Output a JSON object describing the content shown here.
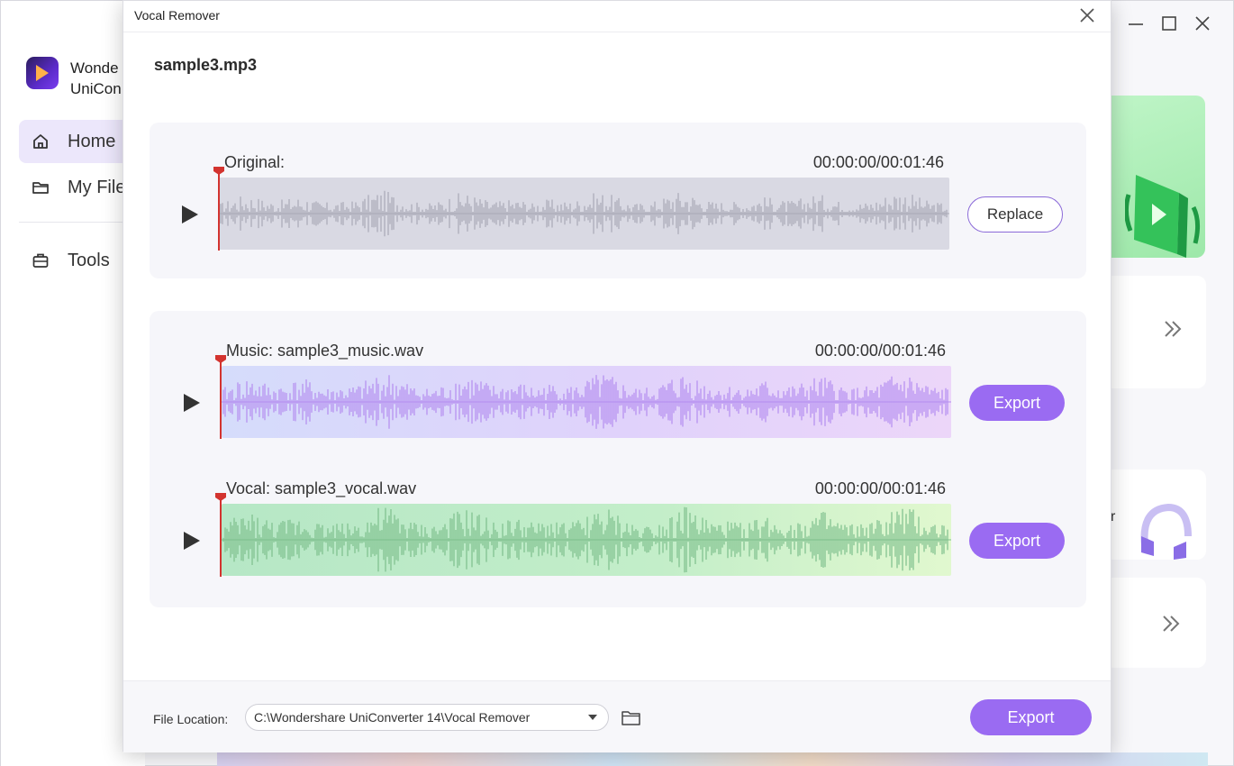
{
  "app": {
    "brand_line1": "Wonde",
    "brand_line2": "UniCon",
    "nav": [
      {
        "label": "Home",
        "icon": "home-icon",
        "active": true
      },
      {
        "label": "My File",
        "icon": "folder-icon"
      },
      {
        "label": "Tools",
        "icon": "toolbox-icon"
      }
    ],
    "partial_text": "r"
  },
  "modal": {
    "title": "Vocal Remover",
    "file_name": "sample3.mp3",
    "original": {
      "label": "Original:",
      "time": "00:00:00/00:01:46",
      "replace_label": "Replace"
    },
    "music": {
      "label": "Music: sample3_music.wav",
      "time": "00:00:00/00:01:46",
      "export_label": "Export"
    },
    "vocal": {
      "label": "Vocal: sample3_vocal.wav",
      "time": "00:00:00/00:01:46",
      "export_label": "Export"
    },
    "footer": {
      "location_label": "File Location:",
      "location_value": "C:\\Wondershare UniConverter 14\\Vocal Remover",
      "export_label": "Export"
    }
  },
  "colors": {
    "accent": "#9a6bf2",
    "playhead": "#d3332f",
    "wave_original": "#a9a9b6",
    "wave_music": "#b48df0",
    "wave_vocal": "#7dbf8c"
  }
}
